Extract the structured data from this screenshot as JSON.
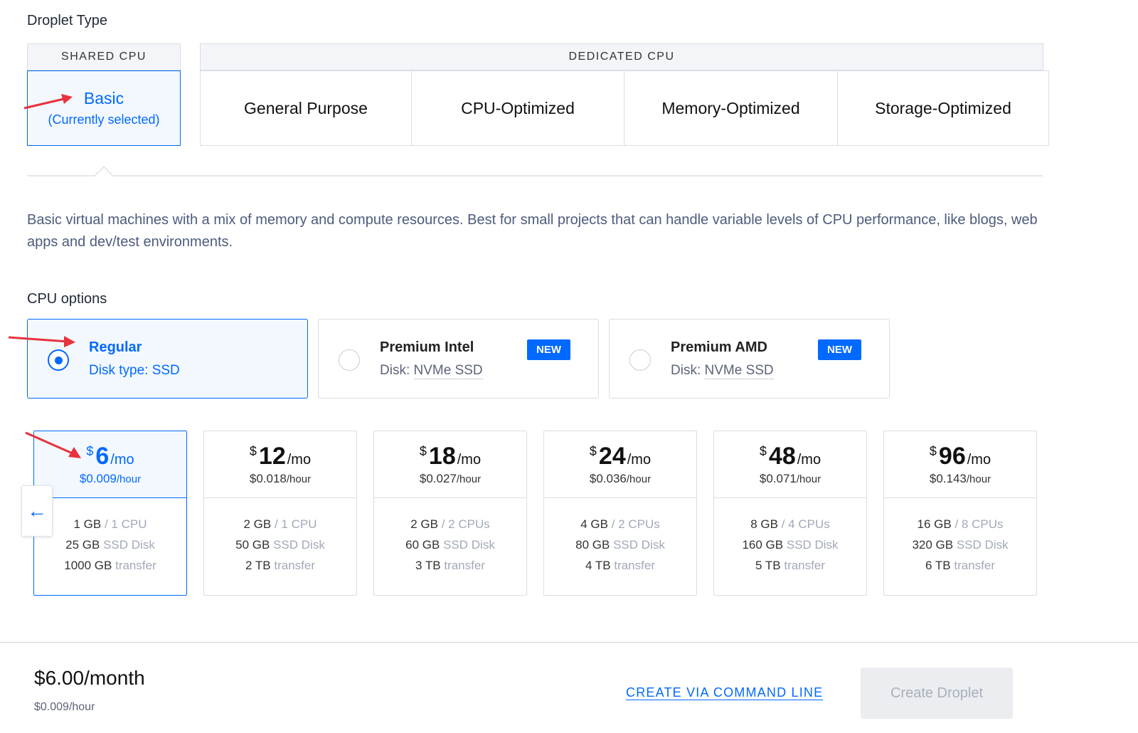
{
  "droplet_type": {
    "title": "Droplet Type",
    "shared_header": "SHARED CPU",
    "dedicated_header": "DEDICATED CPU",
    "basic": {
      "label": "Basic",
      "sub": "(Currently selected)"
    },
    "dedicated_options": [
      "General Purpose",
      "CPU-Optimized",
      "Memory-Optimized",
      "Storage-Optimized"
    ],
    "description": "Basic virtual machines with a mix of memory and compute resources. Best for small projects that can handle variable levels of CPU performance, like blogs, web apps and dev/test environments."
  },
  "cpu_options": {
    "title": "CPU options",
    "items": [
      {
        "name": "Regular",
        "disk_label": "Disk type:",
        "disk_value": "SSD",
        "badge": "",
        "selected": true
      },
      {
        "name": "Premium Intel",
        "disk_label": "Disk:",
        "disk_value": "NVMe SSD",
        "badge": "NEW",
        "selected": false
      },
      {
        "name": "Premium AMD",
        "disk_label": "Disk:",
        "disk_value": "NVMe SSD",
        "badge": "NEW",
        "selected": false
      }
    ]
  },
  "plans": [
    {
      "currency": "$",
      "amount": "6",
      "per": "/mo",
      "hourly": "$0.009",
      "hour_unit": "/hour",
      "ram": "1 GB",
      "cpu": "/ 1 CPU",
      "disk": "25 GB",
      "disk_unit": "SSD Disk",
      "transfer": "1000 GB",
      "transfer_unit": "transfer",
      "selected": true
    },
    {
      "currency": "$",
      "amount": "12",
      "per": "/mo",
      "hourly": "$0.018",
      "hour_unit": "/hour",
      "ram": "2 GB",
      "cpu": "/ 1 CPU",
      "disk": "50 GB",
      "disk_unit": "SSD Disk",
      "transfer": "2 TB",
      "transfer_unit": "transfer",
      "selected": false
    },
    {
      "currency": "$",
      "amount": "18",
      "per": "/mo",
      "hourly": "$0.027",
      "hour_unit": "/hour",
      "ram": "2 GB",
      "cpu": "/ 2 CPUs",
      "disk": "60 GB",
      "disk_unit": "SSD Disk",
      "transfer": "3 TB",
      "transfer_unit": "transfer",
      "selected": false
    },
    {
      "currency": "$",
      "amount": "24",
      "per": "/mo",
      "hourly": "$0.036",
      "hour_unit": "/hour",
      "ram": "4 GB",
      "cpu": "/ 2 CPUs",
      "disk": "80 GB",
      "disk_unit": "SSD Disk",
      "transfer": "4 TB",
      "transfer_unit": "transfer",
      "selected": false
    },
    {
      "currency": "$",
      "amount": "48",
      "per": "/mo",
      "hourly": "$0.071",
      "hour_unit": "/hour",
      "ram": "8 GB",
      "cpu": "/ 4 CPUs",
      "disk": "160 GB",
      "disk_unit": "SSD Disk",
      "transfer": "5 TB",
      "transfer_unit": "transfer",
      "selected": false
    },
    {
      "currency": "$",
      "amount": "96",
      "per": "/mo",
      "hourly": "$0.143",
      "hour_unit": "/hour",
      "ram": "16 GB",
      "cpu": "/ 8 CPUs",
      "disk": "320 GB",
      "disk_unit": "SSD Disk",
      "transfer": "6 TB",
      "transfer_unit": "transfer",
      "selected": false
    }
  ],
  "scroll_icon": "arrow-left-icon",
  "footer": {
    "total": "$6.00/month",
    "hourly": "$0.009/hour",
    "cli_link": "CREATE VIA COMMAND LINE",
    "create_button": "Create Droplet"
  },
  "colors": {
    "accent": "#0069ff",
    "annotation_arrow": "#e8323c",
    "border": "#d9dde5"
  }
}
